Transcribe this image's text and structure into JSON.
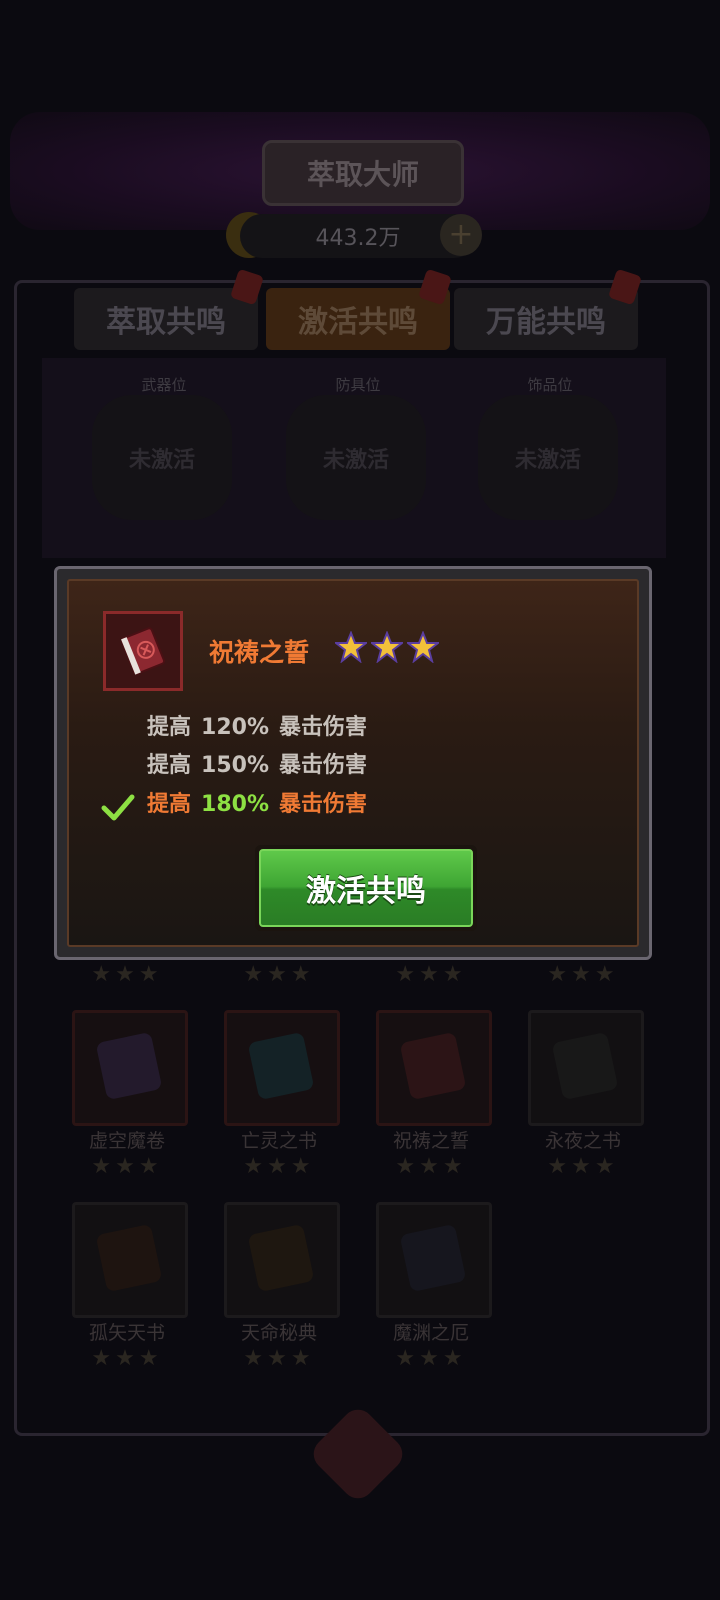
{
  "header": {
    "title": "萃取大师",
    "currency_amount": "443.2万"
  },
  "tabs": [
    {
      "label": "萃取共鸣",
      "active": false
    },
    {
      "label": "激活共鸣",
      "active": true
    },
    {
      "label": "万能共鸣",
      "active": false
    }
  ],
  "slots": [
    {
      "label": "武器位",
      "status": "未激活"
    },
    {
      "label": "防具位",
      "status": "未激活"
    },
    {
      "label": "饰品位",
      "status": "未激活"
    }
  ],
  "grid_items": [
    {
      "name": "虚空魔卷",
      "stars": 3
    },
    {
      "name": "亡灵之书",
      "stars": 3
    },
    {
      "name": "祝祷之誓",
      "stars": 3
    },
    {
      "name": "永夜之书",
      "stars": 3
    },
    {
      "name": "孤矢天书",
      "stars": 3
    },
    {
      "name": "天命秘典",
      "stars": 3
    },
    {
      "name": "魔渊之厄",
      "stars": 3
    }
  ],
  "modal": {
    "item_name": "祝祷之誓",
    "stars": 3,
    "effects": [
      {
        "prefix": "提高",
        "value": "120%",
        "suffix": "暴击伤害",
        "active": false
      },
      {
        "prefix": "提高",
        "value": "150%",
        "suffix": "暴击伤害",
        "active": false
      },
      {
        "prefix": "提高",
        "value": "180%",
        "suffix": "暴击伤害",
        "active": true
      }
    ],
    "button_label": "激活共鸣"
  },
  "colors": {
    "item_name": "#f07a34",
    "active_value": "#8de043",
    "button_green": "#3ea533",
    "star_gold": "#f2c03a"
  }
}
